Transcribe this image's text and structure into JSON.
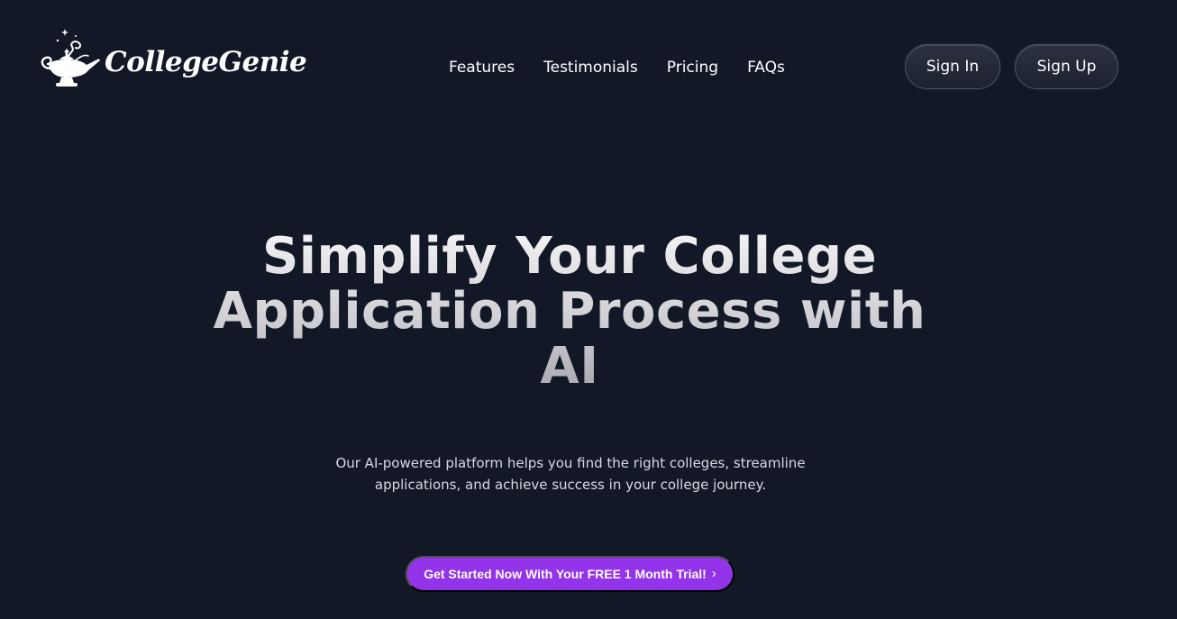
{
  "brand": {
    "name": "CollegeGenie",
    "logo_icon": "magic-lamp-icon"
  },
  "nav": {
    "items": [
      {
        "label": "Features"
      },
      {
        "label": "Testimonials"
      },
      {
        "label": "Pricing"
      },
      {
        "label": "FAQs"
      }
    ]
  },
  "auth": {
    "sign_in_label": "Sign In",
    "sign_up_label": "Sign Up"
  },
  "hero": {
    "title": "Simplify Your College Application Process with AI",
    "subtitle": "Our AI-powered platform helps you find the right colleges, streamline applications, and achieve success in your college journey.",
    "cta_label": "Get Started Now With Your FREE 1 Month Trial!",
    "cta_icon": "chevron-right-icon"
  },
  "colors": {
    "background": "#121826",
    "cta": "#9333ea",
    "button_border": "#4b5466"
  }
}
